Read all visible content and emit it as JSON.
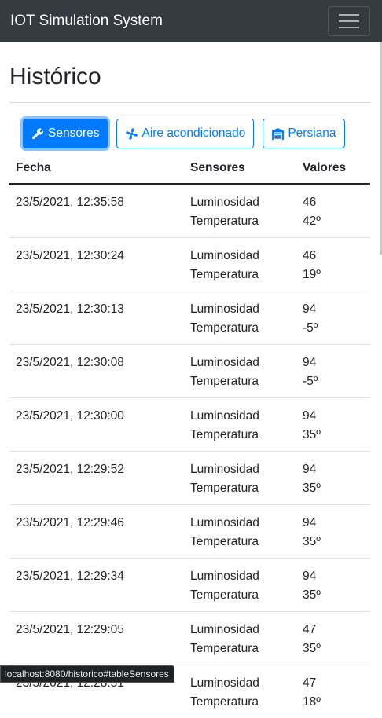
{
  "navbar": {
    "brand": "IOT Simulation System"
  },
  "page": {
    "title": "Histórico"
  },
  "tabs": [
    {
      "label": "Sensores",
      "icon": "wrench-icon",
      "active": true
    },
    {
      "label": "Aire acondicionado",
      "icon": "fan-icon",
      "active": false
    },
    {
      "label": "Persiana",
      "icon": "garage-icon",
      "active": false
    }
  ],
  "table": {
    "headers": [
      "Fecha",
      "Sensores",
      "Valores"
    ],
    "rows": [
      {
        "fecha": "23/5/2021, 12:35:58",
        "sensores": [
          "Luminosidad",
          "Temperatura"
        ],
        "valores": [
          "46",
          "42º"
        ]
      },
      {
        "fecha": "23/5/2021, 12:30:24",
        "sensores": [
          "Luminosidad",
          "Temperatura"
        ],
        "valores": [
          "46",
          "19º"
        ]
      },
      {
        "fecha": "23/5/2021, 12:30:13",
        "sensores": [
          "Luminosidad",
          "Temperatura"
        ],
        "valores": [
          "94",
          "-5º"
        ]
      },
      {
        "fecha": "23/5/2021, 12:30:08",
        "sensores": [
          "Luminosidad",
          "Temperatura"
        ],
        "valores": [
          "94",
          "-5º"
        ]
      },
      {
        "fecha": "23/5/2021, 12:30:00",
        "sensores": [
          "Luminosidad",
          "Temperatura"
        ],
        "valores": [
          "94",
          "35º"
        ]
      },
      {
        "fecha": "23/5/2021, 12:29:52",
        "sensores": [
          "Luminosidad",
          "Temperatura"
        ],
        "valores": [
          "94",
          "35º"
        ]
      },
      {
        "fecha": "23/5/2021, 12:29:46",
        "sensores": [
          "Luminosidad",
          "Temperatura"
        ],
        "valores": [
          "94",
          "35º"
        ]
      },
      {
        "fecha": "23/5/2021, 12:29:34",
        "sensores": [
          "Luminosidad",
          "Temperatura"
        ],
        "valores": [
          "94",
          "35º"
        ]
      },
      {
        "fecha": "23/5/2021, 12:29:05",
        "sensores": [
          "Luminosidad",
          "Temperatura"
        ],
        "valores": [
          "47",
          "35º"
        ]
      },
      {
        "fecha": "23/5/2021, 12:28:51",
        "sensores": [
          "Luminosidad",
          "Temperatura"
        ],
        "valores": [
          "47",
          "18º"
        ]
      }
    ]
  },
  "statusbar": {
    "url": "localhost:8080/historico#tableSensores"
  },
  "colors": {
    "navbar": "#343a40",
    "primary": "#007bff"
  }
}
